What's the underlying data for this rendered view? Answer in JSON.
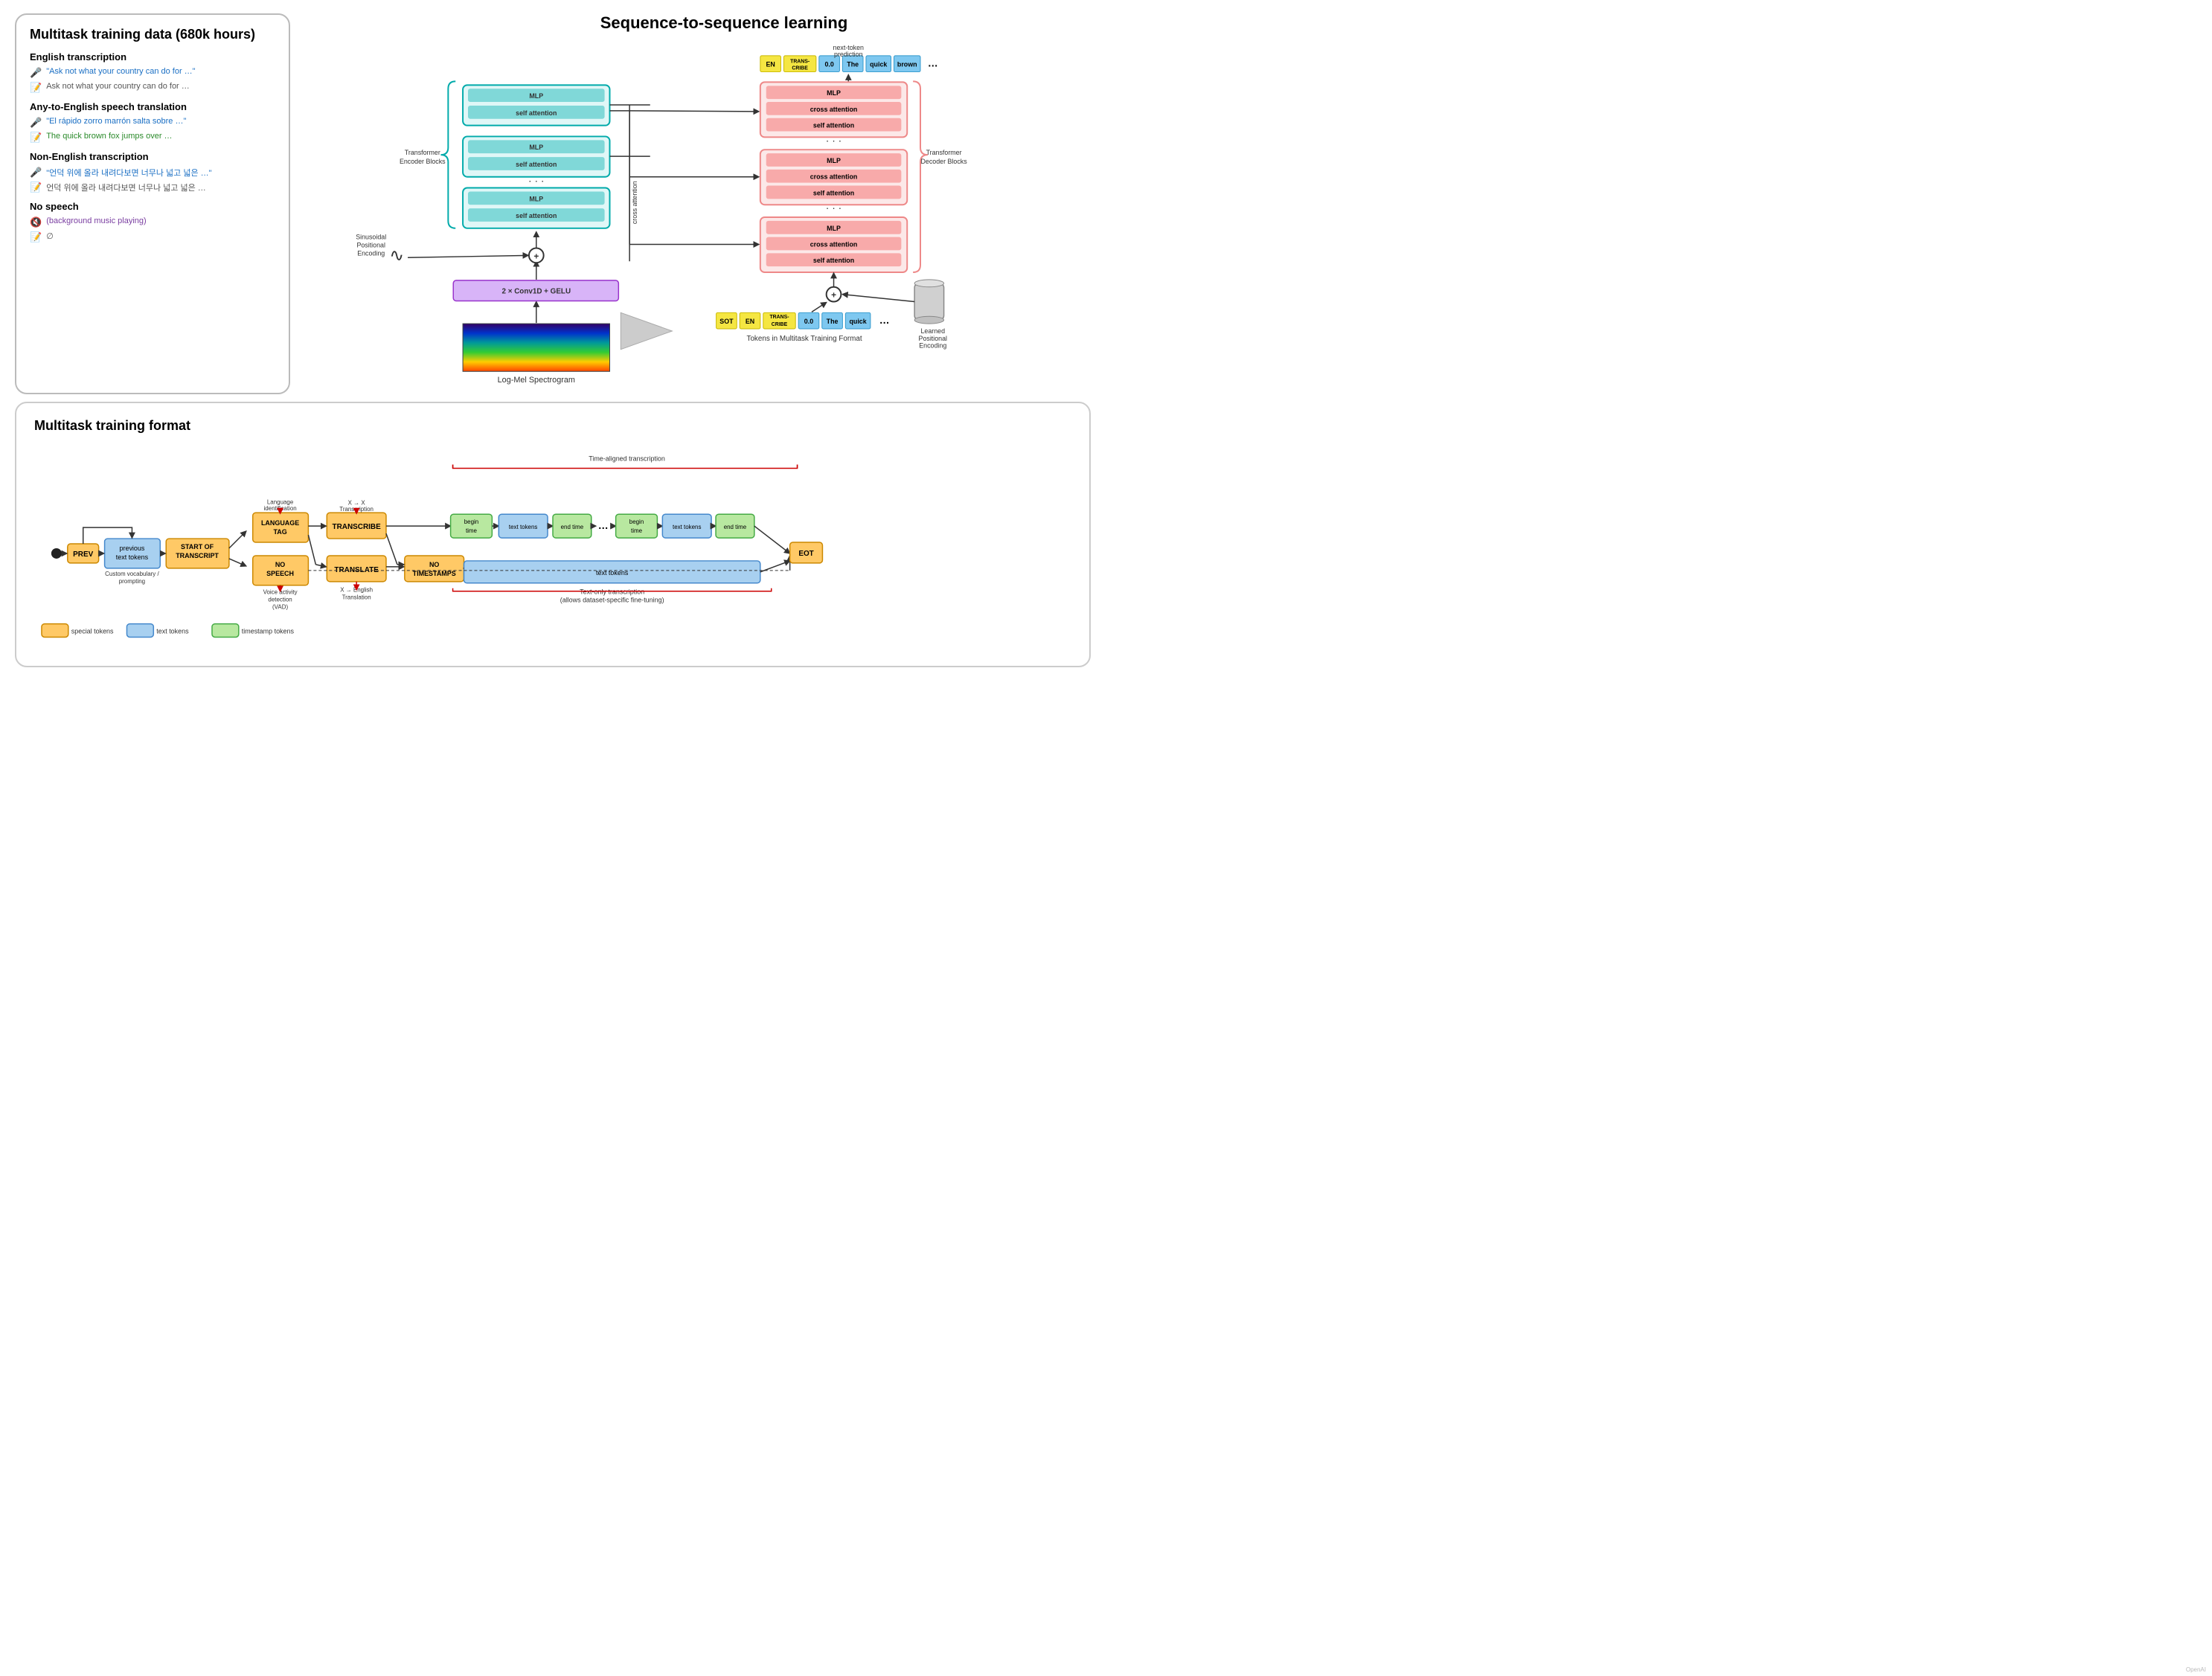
{
  "top": {
    "left_panel": {
      "title": "Multitask training data (680k hours)",
      "sections": [
        {
          "label": "English transcription",
          "rows": [
            {
              "icon": "🎤",
              "text": "\"Ask not what your country can do for …\"",
              "style": "blue"
            },
            {
              "icon": "📝",
              "text": "Ask not what your country can do for …",
              "style": "gray"
            }
          ]
        },
        {
          "label": "Any-to-English speech translation",
          "rows": [
            {
              "icon": "🎤",
              "text": "\"El rápido zorro marrón salta sobre …\"",
              "style": "blue"
            },
            {
              "icon": "📝",
              "text": "The quick brown fox jumps over …",
              "style": "green"
            }
          ]
        },
        {
          "label": "Non-English transcription",
          "rows": [
            {
              "icon": "🎤",
              "text": "\"언덕 위에 올라 내려다보면 너무나 넓고 넓은 …\"",
              "style": "blue"
            },
            {
              "icon": "📝",
              "text": "언덕 위에 올라 내려다보면 너무나 넓고 넓은 …",
              "style": "gray"
            }
          ]
        },
        {
          "label": "No speech",
          "rows": [
            {
              "icon": "🔇",
              "text": "(background music playing)",
              "style": "purple"
            },
            {
              "icon": "📝",
              "text": "∅",
              "style": "gray"
            }
          ]
        }
      ]
    },
    "seq_title": "Sequence-to-sequence learning",
    "encoder": {
      "label": "Transformer\nEncoder Blocks",
      "sine_label": "Sinusoidal\nPositional\nEncoding",
      "conv_label": "2 × Conv1D + GELU",
      "spectrogram_label": "Log-Mel Spectrogram",
      "blocks": [
        {
          "mlp": "MLP",
          "sa": "self attention"
        },
        {
          "mlp": "MLP",
          "sa": "self attention"
        },
        {
          "mlp": "MLP",
          "sa": "self attention"
        }
      ]
    },
    "decoder": {
      "label": "Transformer\nDecoder Blocks",
      "learned_pos_label": "Learned\nPositional\nEncoding",
      "cross_attention_label": "cross attention",
      "next_token_label": "next-token\nprediction",
      "blocks": [
        {
          "mlp": "MLP",
          "ca": "cross attention",
          "sa": "self attention"
        },
        {
          "mlp": "MLP",
          "ca": "cross attention",
          "sa": "self attention"
        },
        {
          "mlp": "MLP",
          "ca": "cross attention",
          "sa": "self attention"
        }
      ],
      "output_tokens": [
        "EN",
        "TRANSCRIBE",
        "0.0",
        "The",
        "quick",
        "brown",
        "…"
      ],
      "input_tokens": [
        "SOT",
        "EN",
        "TRANSCRIBE",
        "0.0",
        "The",
        "quick",
        "…"
      ],
      "tokens_label": "Tokens in Multitask Training Format"
    }
  },
  "bottom": {
    "title": "Multitask training format",
    "nodes": {
      "start_dot": "●",
      "prev": "PREV",
      "prev_text_tokens": "previous\ntext tokens",
      "start_of_transcript": "START OF\nTRANSCRIPT",
      "language_tag": "LANGUAGE\nTAG",
      "no_speech": "NO\nSPEECH",
      "transcribe": "TRANSCRIBE",
      "translate": "TRANSLATE",
      "no_timestamps": "NO\nTIMESTAMPS",
      "begin_time1": "begin\ntime",
      "text_tokens1": "text tokens",
      "end_time1": "end time",
      "dots": "…",
      "begin_time2": "begin\ntime",
      "text_tokens2": "text tokens",
      "end_time2": "end time",
      "eot": "EOT",
      "text_tokens_long": "text tokens"
    },
    "labels": {
      "custom_vocab": "Custom vocabulary /\nprompting",
      "language_id": "Language\nidentification",
      "voice_activity": "Voice activity\ndetection\n(VAD)",
      "x_to_x": "X → X\nTranscription",
      "x_to_en": "X → English\nTranslation",
      "time_aligned": "Time-aligned transcription",
      "text_only": "Text-only transcription\n(allows dataset-specific fine-tuning)"
    },
    "legend": [
      {
        "label": "special tokens",
        "color": "#ffc966",
        "border": "#cc8800"
      },
      {
        "label": "text tokens",
        "color": "#a8d0f0",
        "border": "#4488cc"
      },
      {
        "label": "timestamp tokens",
        "color": "#b8e8a0",
        "border": "#44aa44"
      }
    ]
  }
}
